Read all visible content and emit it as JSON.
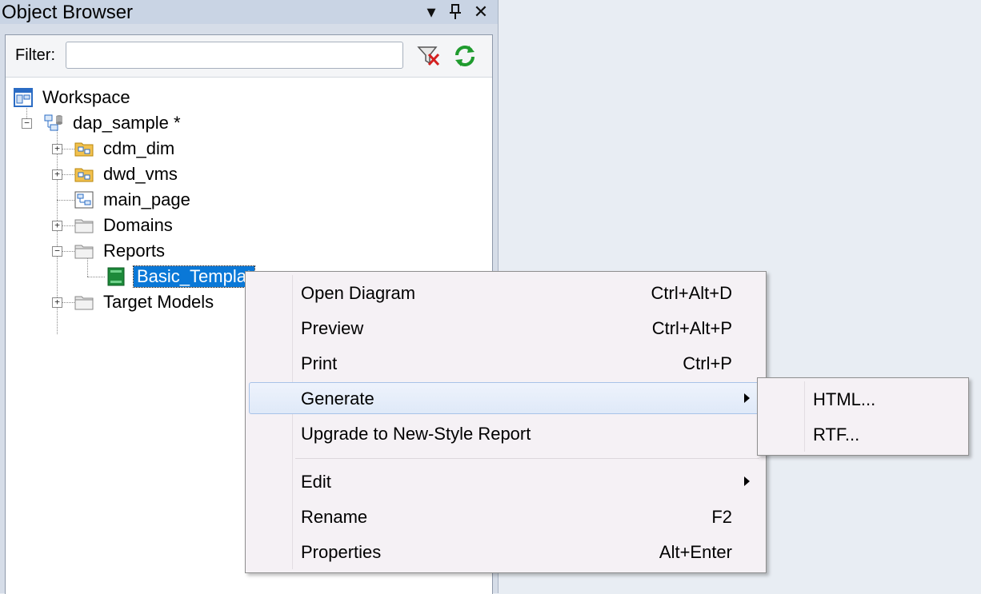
{
  "panel": {
    "title": "Object Browser",
    "buttons": {
      "dropdown": "▾",
      "pin": "ᵠ",
      "close": "✕"
    }
  },
  "filter": {
    "label": "Filter:",
    "value": "",
    "placeholder": ""
  },
  "tree": {
    "workspace": "Workspace",
    "project": "dap_sample *",
    "items": {
      "cdm_dim": "cdm_dim",
      "dwd_vms": "dwd_vms",
      "main_page": "main_page",
      "domains": "Domains",
      "reports": "Reports",
      "basic_template": "Basic_Templat",
      "target_models": "Target Models"
    }
  },
  "context_menu": {
    "items": [
      {
        "label": "Open Diagram",
        "shortcut": "Ctrl+Alt+D"
      },
      {
        "label": "Preview",
        "shortcut": "Ctrl+Alt+P"
      },
      {
        "label": "Print",
        "shortcut": "Ctrl+P"
      },
      {
        "label": "Generate",
        "shortcut": ""
      },
      {
        "label": "Upgrade to New-Style Report",
        "shortcut": ""
      },
      {
        "label": "Edit",
        "shortcut": ""
      },
      {
        "label": "Rename",
        "shortcut": "F2"
      },
      {
        "label": "Properties",
        "shortcut": "Alt+Enter"
      }
    ]
  },
  "submenu": {
    "items": [
      {
        "label": "HTML..."
      },
      {
        "label": "RTF..."
      }
    ]
  },
  "colors": {
    "selection": "#0a78d7",
    "menu_bg": "#f5f1f5",
    "panel_bg": "#d6dde8",
    "desktop_bg": "#e8edf3"
  }
}
